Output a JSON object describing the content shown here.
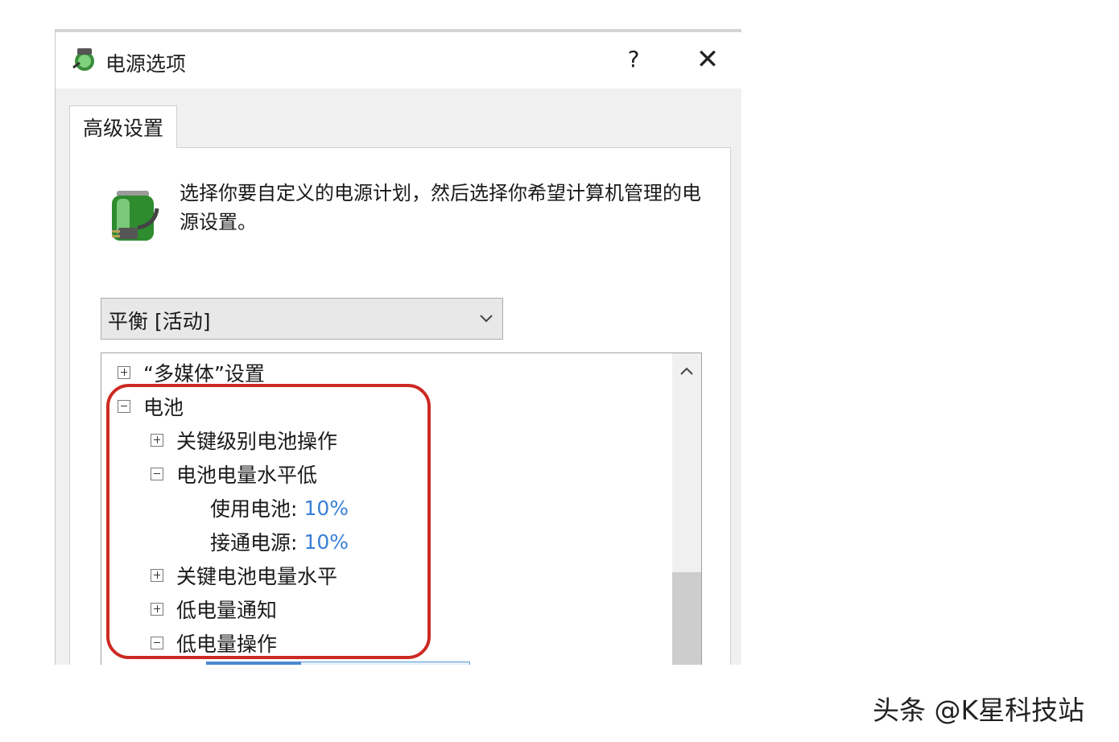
{
  "window": {
    "title": "电源选项",
    "help_label": "?",
    "close_label": "✕",
    "app_icon": "power-options-icon"
  },
  "tab": {
    "label": "高级设置"
  },
  "description": "选择你要自定义的电源计划，然后选择你希望计算机管理的电源设置。",
  "plan_select": {
    "value": "平衡 [活动]",
    "icon": "chevron-down-icon"
  },
  "tree": {
    "items": [
      {
        "label": "“多媒体”设置",
        "expanded": false
      },
      {
        "label": "电池",
        "expanded": true
      },
      {
        "label": "关键级别电池操作",
        "expanded": false
      },
      {
        "label": "电池电量水平低",
        "expanded": true
      },
      {
        "label": "使用电池:",
        "value": "10%"
      },
      {
        "label": "接通电源:",
        "value": "10%"
      },
      {
        "label": "关键电池电量水平",
        "expanded": false
      },
      {
        "label": "低电量通知",
        "expanded": false
      },
      {
        "label": "低电量操作",
        "expanded": true
      }
    ]
  },
  "colors": {
    "highlight": "#cc2a23",
    "value_text": "#3a7fd5"
  },
  "watermark": "头条 @K星科技站"
}
